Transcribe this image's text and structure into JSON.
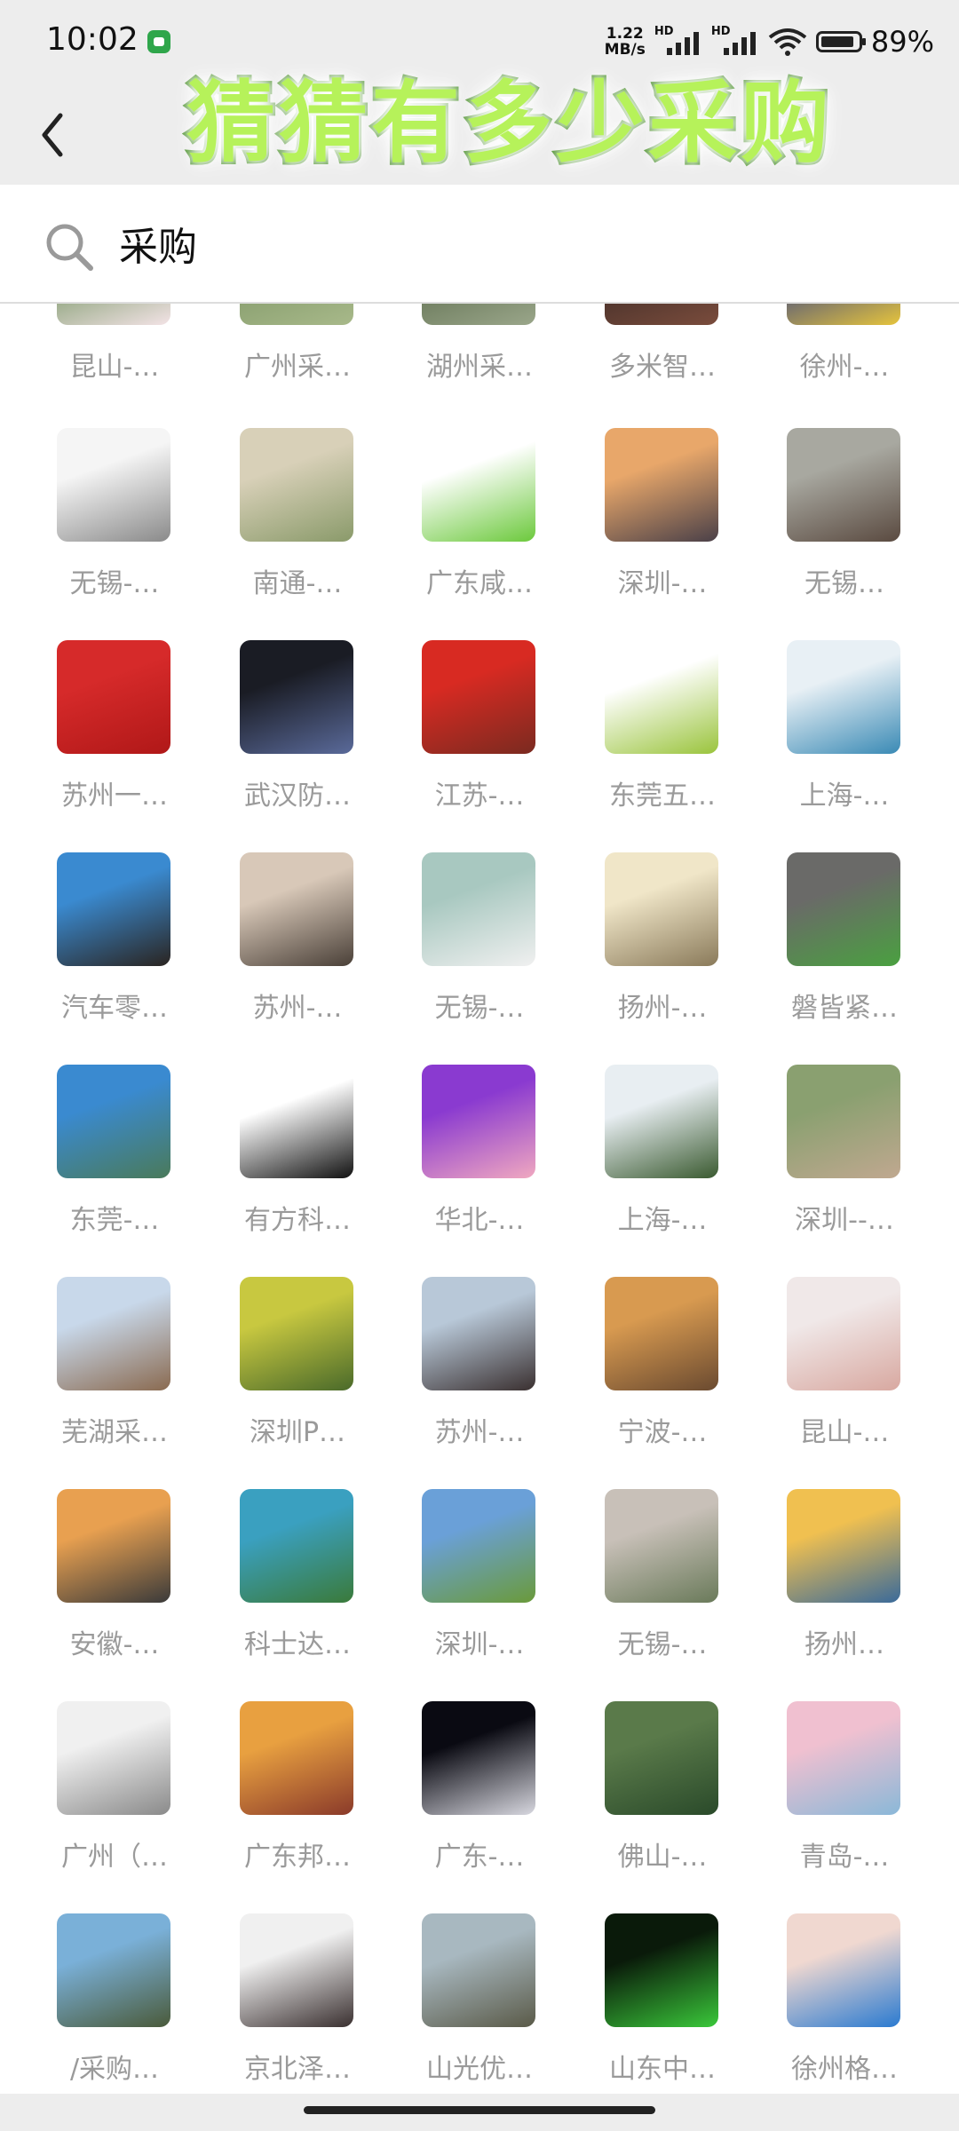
{
  "status_bar": {
    "time": "10:02",
    "net_speed_value": "1.22",
    "net_speed_unit": "MB/s",
    "sim1_label": "HD",
    "sim2_label": "HD",
    "battery_percent": "89%",
    "app_icon": "wechat-notification-icon"
  },
  "header": {
    "back_icon": "chevron-left-icon",
    "overlay_title": "猜猜有多少采购"
  },
  "search": {
    "icon": "search-icon",
    "query": "采购"
  },
  "colors": {
    "background": "#ededed",
    "label": "#9a9a9a",
    "overlay_fill": "#b6f25a",
    "overlay_stroke": "#3f8a1d"
  },
  "grid": {
    "rows": [
      {
        "items": [
          {
            "name": "昆山-…",
            "colors": [
              "#6c8f5a",
              "#f3e3e6"
            ]
          },
          {
            "name": "广州采…",
            "colors": [
              "#7e9666",
              "#a8b98a"
            ]
          },
          {
            "name": "湖州采…",
            "colors": [
              "#5b6b4c",
              "#9aa68a"
            ]
          },
          {
            "name": "多米智…",
            "colors": [
              "#3b2a26",
              "#7a4c3c"
            ]
          },
          {
            "name": "徐州-…",
            "colors": [
              "#2b3a8c",
              "#e6c43c"
            ]
          }
        ]
      },
      {
        "items": [
          {
            "name": "无锡-…",
            "colors": [
              "#f5f5f5",
              "#8a8a8a"
            ]
          },
          {
            "name": "南通-…",
            "colors": [
              "#d8d0b8",
              "#8a9a6a"
            ]
          },
          {
            "name": "广东咸…",
            "colors": [
              "#ffffff",
              "#6cc93c"
            ]
          },
          {
            "name": "深圳-…",
            "colors": [
              "#e8a76a",
              "#4a4048"
            ]
          },
          {
            "name": "无锡…",
            "colors": [
              "#a8a8a0",
              "#5a4a40"
            ]
          }
        ]
      },
      {
        "items": [
          {
            "name": "苏州一…",
            "colors": [
              "#d62a2a",
              "#b01818"
            ]
          },
          {
            "name": "武汉防…",
            "colors": [
              "#1a1c24",
              "#5a6a9a"
            ]
          },
          {
            "name": "江苏-…",
            "colors": [
              "#d82a22",
              "#7a2a20"
            ]
          },
          {
            "name": "东莞五…",
            "colors": [
              "#ffffff",
              "#9ac43c"
            ]
          },
          {
            "name": "上海-…",
            "colors": [
              "#e8f0f5",
              "#3a8ab5"
            ]
          }
        ]
      },
      {
        "items": [
          {
            "name": "汽车零…",
            "colors": [
              "#3a8ad0",
              "#2a2420"
            ]
          },
          {
            "name": "苏州-…",
            "colors": [
              "#d8c8b8",
              "#4a4038"
            ]
          },
          {
            "name": "无锡-…",
            "colors": [
              "#a8c8c0",
              "#f0f0f0"
            ]
          },
          {
            "name": "扬州-…",
            "colors": [
              "#f0e6c8",
              "#8a7a5a"
            ]
          },
          {
            "name": "磐皆紧…",
            "colors": [
              "#6a6a68",
              "#4aa040"
            ]
          }
        ]
      },
      {
        "items": [
          {
            "name": "东莞-…",
            "colors": [
              "#3a8ad0",
              "#4a7a5a"
            ]
          },
          {
            "name": "有方科…",
            "colors": [
              "#ffffff",
              "#111111"
            ]
          },
          {
            "name": "华北-…",
            "colors": [
              "#8a3ad0",
              "#f0a8c0"
            ]
          },
          {
            "name": "上海-…",
            "colors": [
              "#e8eef2",
              "#3a5a30"
            ]
          },
          {
            "name": "深圳--…",
            "colors": [
              "#8aa070",
              "#c0a890"
            ]
          }
        ]
      },
      {
        "items": [
          {
            "name": "芜湖采…",
            "colors": [
              "#c8d8ea",
              "#8a6a50"
            ]
          },
          {
            "name": "深圳P…",
            "colors": [
              "#c8c840",
              "#4a6a2a"
            ]
          },
          {
            "name": "苏州-…",
            "colors": [
              "#b8c8d8",
              "#3a3030"
            ]
          },
          {
            "name": "宁波-…",
            "colors": [
              "#d89a50",
              "#6a4a30"
            ]
          },
          {
            "name": "昆山-…",
            "colors": [
              "#f0e8e8",
              "#d8a8a0"
            ]
          }
        ]
      },
      {
        "items": [
          {
            "name": "安徽-…",
            "colors": [
              "#e8a050",
              "#3a3a3a"
            ]
          },
          {
            "name": "科士达…",
            "colors": [
              "#3aa0c0",
              "#3a7a3a"
            ]
          },
          {
            "name": "深圳-…",
            "colors": [
              "#6aa0d8",
              "#6a9a3a"
            ]
          },
          {
            "name": "无锡-…",
            "colors": [
              "#c8c0b8",
              "#6a7a5a"
            ]
          },
          {
            "name": "扬州…",
            "colors": [
              "#f0c050",
              "#3a6a9a"
            ]
          }
        ]
      },
      {
        "items": [
          {
            "name": "广州（…",
            "colors": [
              "#f0f0f0",
              "#8a8a8a"
            ]
          },
          {
            "name": "广东邦…",
            "colors": [
              "#e8a040",
              "#8a3a2a"
            ]
          },
          {
            "name": "广东-…",
            "colors": [
              "#0a0a12",
              "#d8d8e0"
            ]
          },
          {
            "name": "佛山-…",
            "colors": [
              "#5a7a4a",
              "#2a4a2a"
            ]
          },
          {
            "name": "青岛-…",
            "colors": [
              "#f0c0d0",
              "#8ab8d8"
            ]
          }
        ]
      },
      {
        "items": [
          {
            "name": "/采购…",
            "colors": [
              "#7ab0d8",
              "#4a5a3a"
            ]
          },
          {
            "name": "京北泽…",
            "colors": [
              "#f0f0f0",
              "#3a3030"
            ]
          },
          {
            "name": "山光优…",
            "colors": [
              "#a8b8c0",
              "#5a5a48"
            ]
          },
          {
            "name": "山东中…",
            "colors": [
              "#0a1a0a",
              "#3ac83a"
            ]
          },
          {
            "name": "徐州格…",
            "colors": [
              "#f0d8d0",
              "#2a7ad0"
            ]
          }
        ]
      }
    ]
  },
  "bottom": {
    "home_indicator": "home-indicator"
  }
}
